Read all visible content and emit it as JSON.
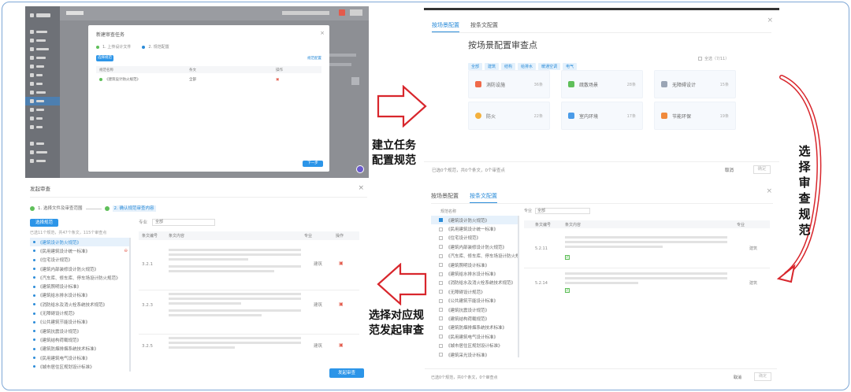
{
  "captions": {
    "step1_line1": "建立任务",
    "step1_line2": "配置规范",
    "step2_chars": [
      "选",
      "择",
      "审",
      "查",
      "规",
      "范"
    ],
    "step3_line1": "选择对应规",
    "step3_line2": "范发起审查"
  },
  "panel_scene": {
    "tabs": [
      "按场景配置",
      "按条文配置"
    ],
    "heading": "按场景配置审查点",
    "chips": [
      "全部",
      "建筑",
      "结构",
      "给排水",
      "暖通空调",
      "电气"
    ],
    "scenes": [
      {
        "name": "消防设施",
        "count": "36条",
        "color": "#ef6a4a"
      },
      {
        "name": "疏散场景",
        "count": "28条",
        "color": "#5fbf5a"
      },
      {
        "name": "无障碍设计",
        "count": "15条",
        "color": "#9aa5b5"
      },
      {
        "name": "防火",
        "count": "22条",
        "color": "#f3b03d"
      },
      {
        "name": "室内环境",
        "count": "17条",
        "color": "#4a9be8"
      },
      {
        "name": "节能环保",
        "count": "19条",
        "color": "#f08a3c"
      }
    ],
    "footer_text": "已选0个规范，共0个条文，0个审查点",
    "cancel": "取消",
    "confirm": "确定"
  },
  "panel_task": {
    "dialog_title": "新建审查任务",
    "steps": [
      "1. 上传设计文件",
      "2. 规范配置"
    ],
    "select_btn": "选择规范",
    "link": "规范配置",
    "columns": [
      "规范名称",
      "条文",
      "操作"
    ],
    "row_text": "《建筑设计防火规范》",
    "row_value": "全部",
    "next_btn": "下一步"
  },
  "panel_review": {
    "title": "发起审查",
    "steps": [
      "1. 选择文件及审查范围",
      "2. 确认规范审查内容"
    ],
    "select_btn": "选择规范",
    "filter_label": "专业",
    "filter_value": "全部",
    "summary": "已选11个规范，共47个条文，115个审查点",
    "rules": [
      "《建筑设计防火规范》",
      "《民用建筑设计统一标准》",
      "《住宅设计规范》",
      "《建筑内部装修设计防火规范》",
      "《汽车库、修车库、停车场设计防火规范》",
      "《建筑照明设计标准》",
      "《建筑给水排水设计标准》",
      "《消防给水及消火栓系统技术规范》",
      "《无障碍设计规范》",
      "《公共建筑节能设计标准》",
      "《建筑抗震设计规范》",
      "《建筑结构荷载规范》",
      "《建筑防烟排烟系统技术标准》",
      "《民用建筑电气设计标准》",
      "《城市居住区规划设计标准》"
    ],
    "columns": [
      "条文编号",
      "条文内容",
      "专业",
      "操作"
    ],
    "rows": [
      {
        "no": "3.2.1",
        "major": "建筑"
      },
      {
        "no": "3.2.3",
        "major": "建筑"
      },
      {
        "no": "3.2.5",
        "major": "建筑"
      }
    ],
    "start_btn": "发起审查"
  },
  "panel_clause": {
    "tabs": [
      "按场景配置",
      "按条文配置"
    ],
    "search_label": "规范名称",
    "filter_label": "专业",
    "filter_value": "全部",
    "rules": [
      "《建筑设计防火规范》",
      "《民用建筑设计统一标准》",
      "《住宅设计规范》",
      "《建筑内部装修设计防火规范》",
      "《汽车库、修车库、停车场设计防火规范》",
      "《建筑照明设计标准》",
      "《建筑给水排水设计标准》",
      "《消防给水及消火栓系统技术规范》",
      "《无障碍设计规范》",
      "《公共建筑节能设计标准》",
      "《建筑抗震设计规范》",
      "《建筑结构荷载规范》",
      "《建筑防烟排烟系统技术标准》",
      "《民用建筑电气设计标准》",
      "《城市居住区规划设计标准》",
      "《建筑采光设计标准》"
    ],
    "columns": [
      "条文编号",
      "条文内容",
      "专业"
    ],
    "rows": [
      {
        "no": "5.2.11",
        "major": "建筑"
      },
      {
        "no": "5.2.14",
        "major": "建筑"
      }
    ],
    "footer_text": "已选0个规范，共0个条文，0个审查点",
    "cancel": "取消",
    "confirm": "确定"
  }
}
